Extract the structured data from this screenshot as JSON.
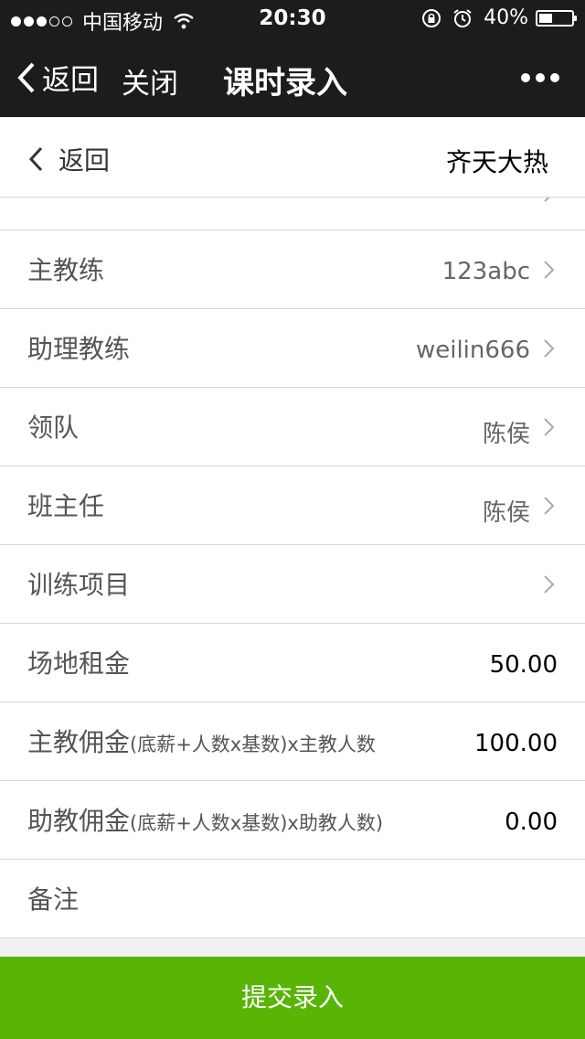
{
  "status_bar": {
    "carrier": "中国移动",
    "time": "20:30",
    "battery": "40%",
    "battery_level": 0.4
  },
  "nav": {
    "back_label": "返回",
    "close_label": "关闭",
    "title": "课时录入"
  },
  "sub_header": {
    "back_label": "返回",
    "right_text": "齐天大热"
  },
  "rows": [
    {
      "label": "",
      "sub": "",
      "value": ""
    },
    {
      "label": "主教练",
      "sub": "",
      "value": "123abc"
    },
    {
      "label": "助理教练",
      "sub": "",
      "value": "weilin666"
    },
    {
      "label": "领队",
      "sub": "",
      "value": "陈侯"
    },
    {
      "label": "班主任",
      "sub": "",
      "value": "陈侯"
    },
    {
      "label": "训练项目",
      "sub": "",
      "value": ""
    },
    {
      "label": "场地租金",
      "sub": "",
      "value": "50.00"
    },
    {
      "label": "主教佣金",
      "sub": "(底薪+人数x基数)x主教人数",
      "value": "100.00"
    },
    {
      "label": "助教佣金",
      "sub": "(底薪+人数x基数)x助教人数)",
      "value": "0.00"
    },
    {
      "label": "备注",
      "sub": "",
      "value": ""
    }
  ],
  "submit_label": "提交录入"
}
